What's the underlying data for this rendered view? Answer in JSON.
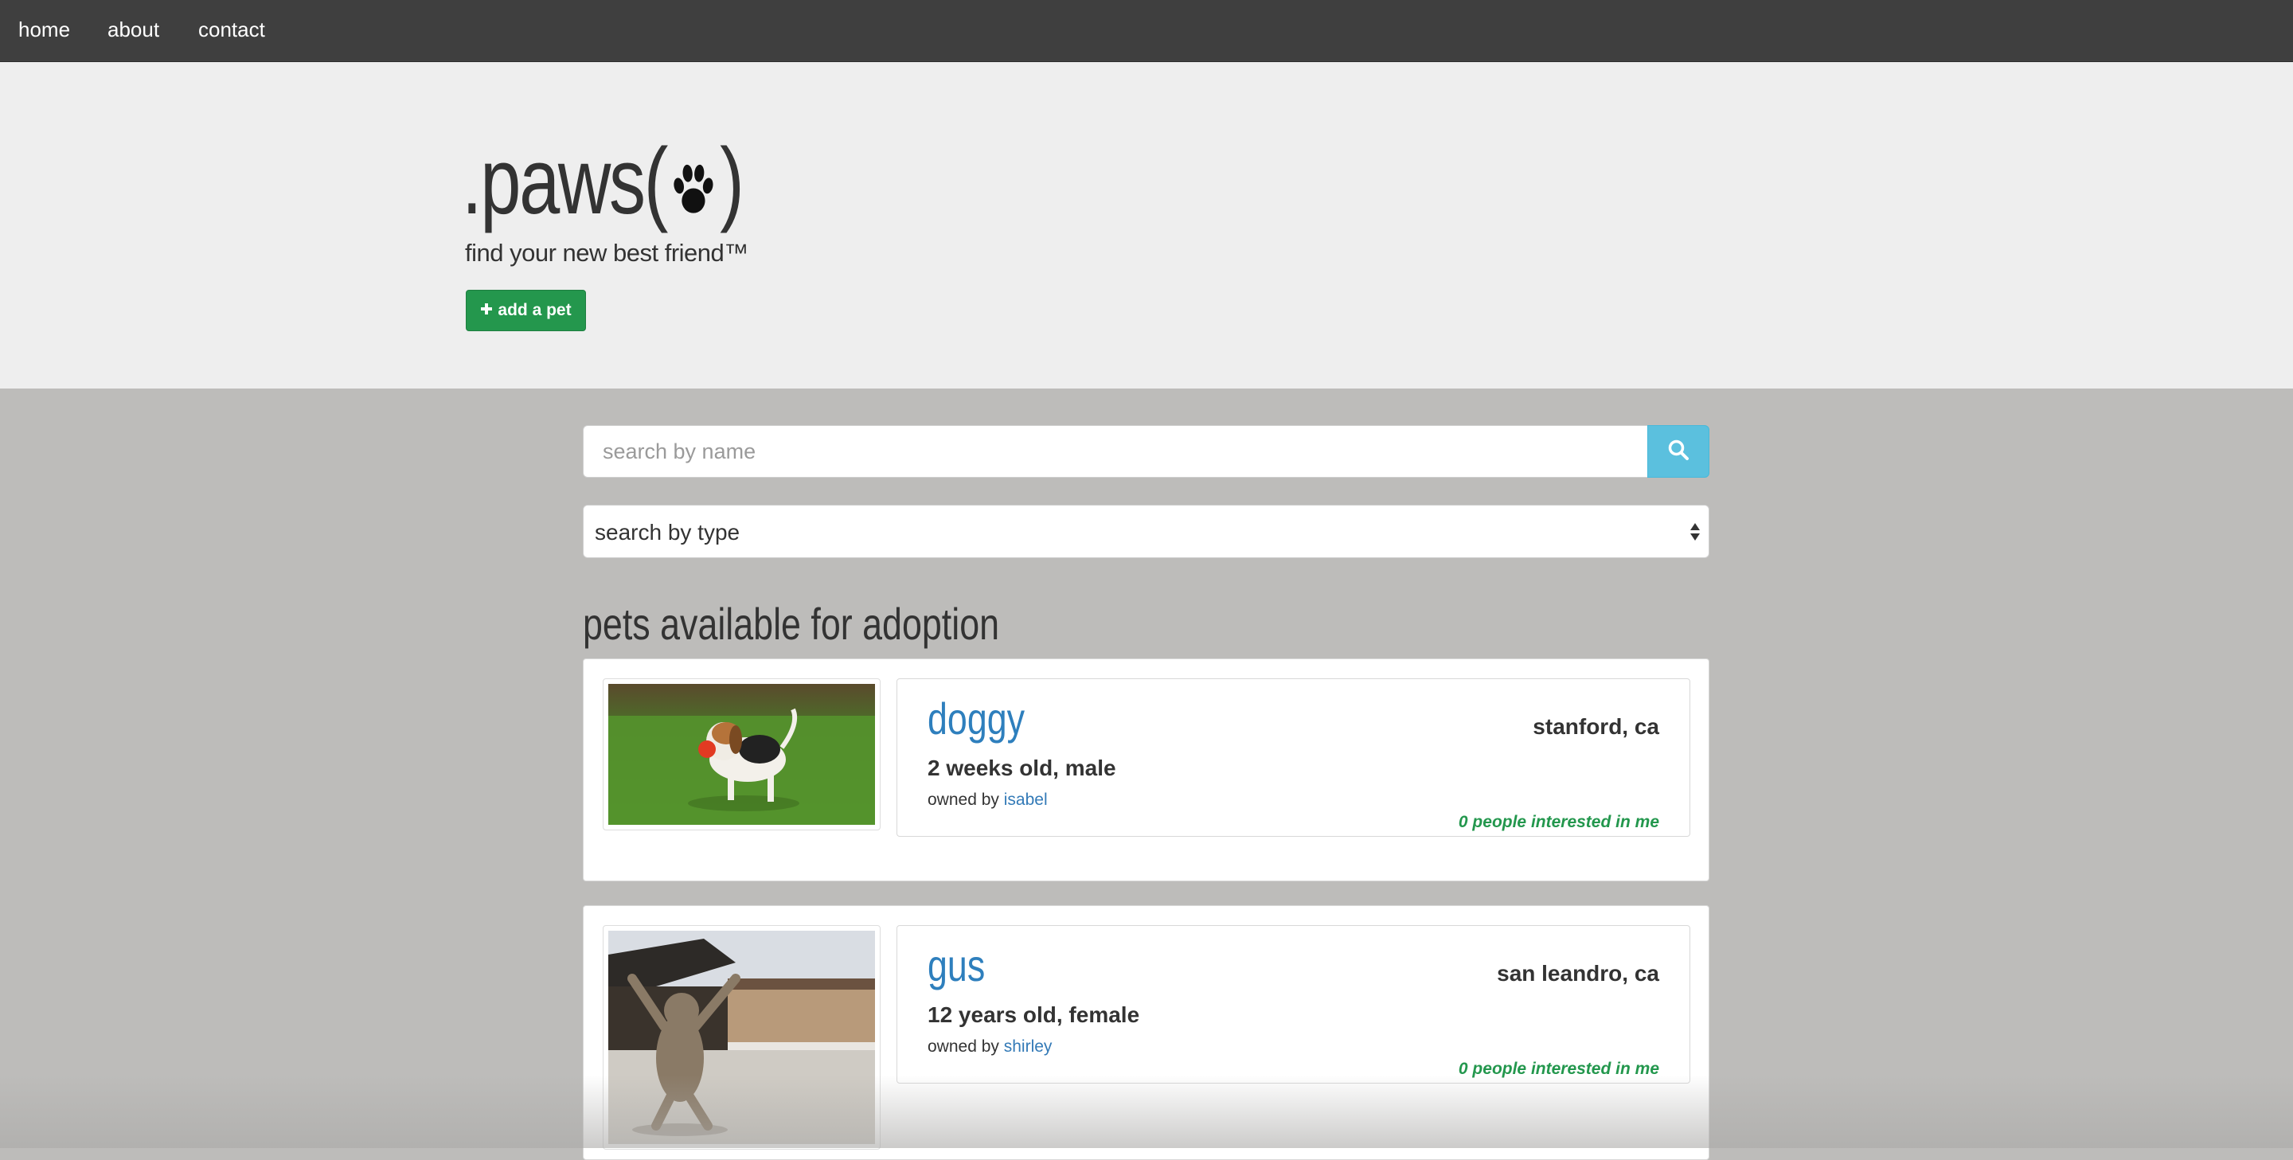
{
  "nav": {
    "items": [
      "home",
      "about",
      "contact"
    ]
  },
  "hero": {
    "logo_prefix": ".paws(",
    "logo_suffix": ")",
    "tagline": "find your new best friend™",
    "add_button": "add a pet"
  },
  "search": {
    "name_placeholder": "search by name",
    "type_placeholder": "search by type"
  },
  "section": {
    "heading": "pets available for adoption"
  },
  "pets": [
    {
      "name": "doggy",
      "age_sex": "2 weeks old, male",
      "owned_by_label": "owned by",
      "owner": "isabel",
      "location": "stanford, ca",
      "interest": "0 people interested in me"
    },
    {
      "name": "gus",
      "age_sex": "12 years old, female",
      "owned_by_label": "owned by",
      "owner": "shirley",
      "location": "san leandro, ca",
      "interest": "0 people interested in me"
    }
  ],
  "colors": {
    "navbar": "#3f3f3f",
    "hero_bg": "#eeeeee",
    "page_bg": "#bdbcba",
    "success": "#24974d",
    "info": "#5bc0de",
    "link": "#337ab7"
  }
}
